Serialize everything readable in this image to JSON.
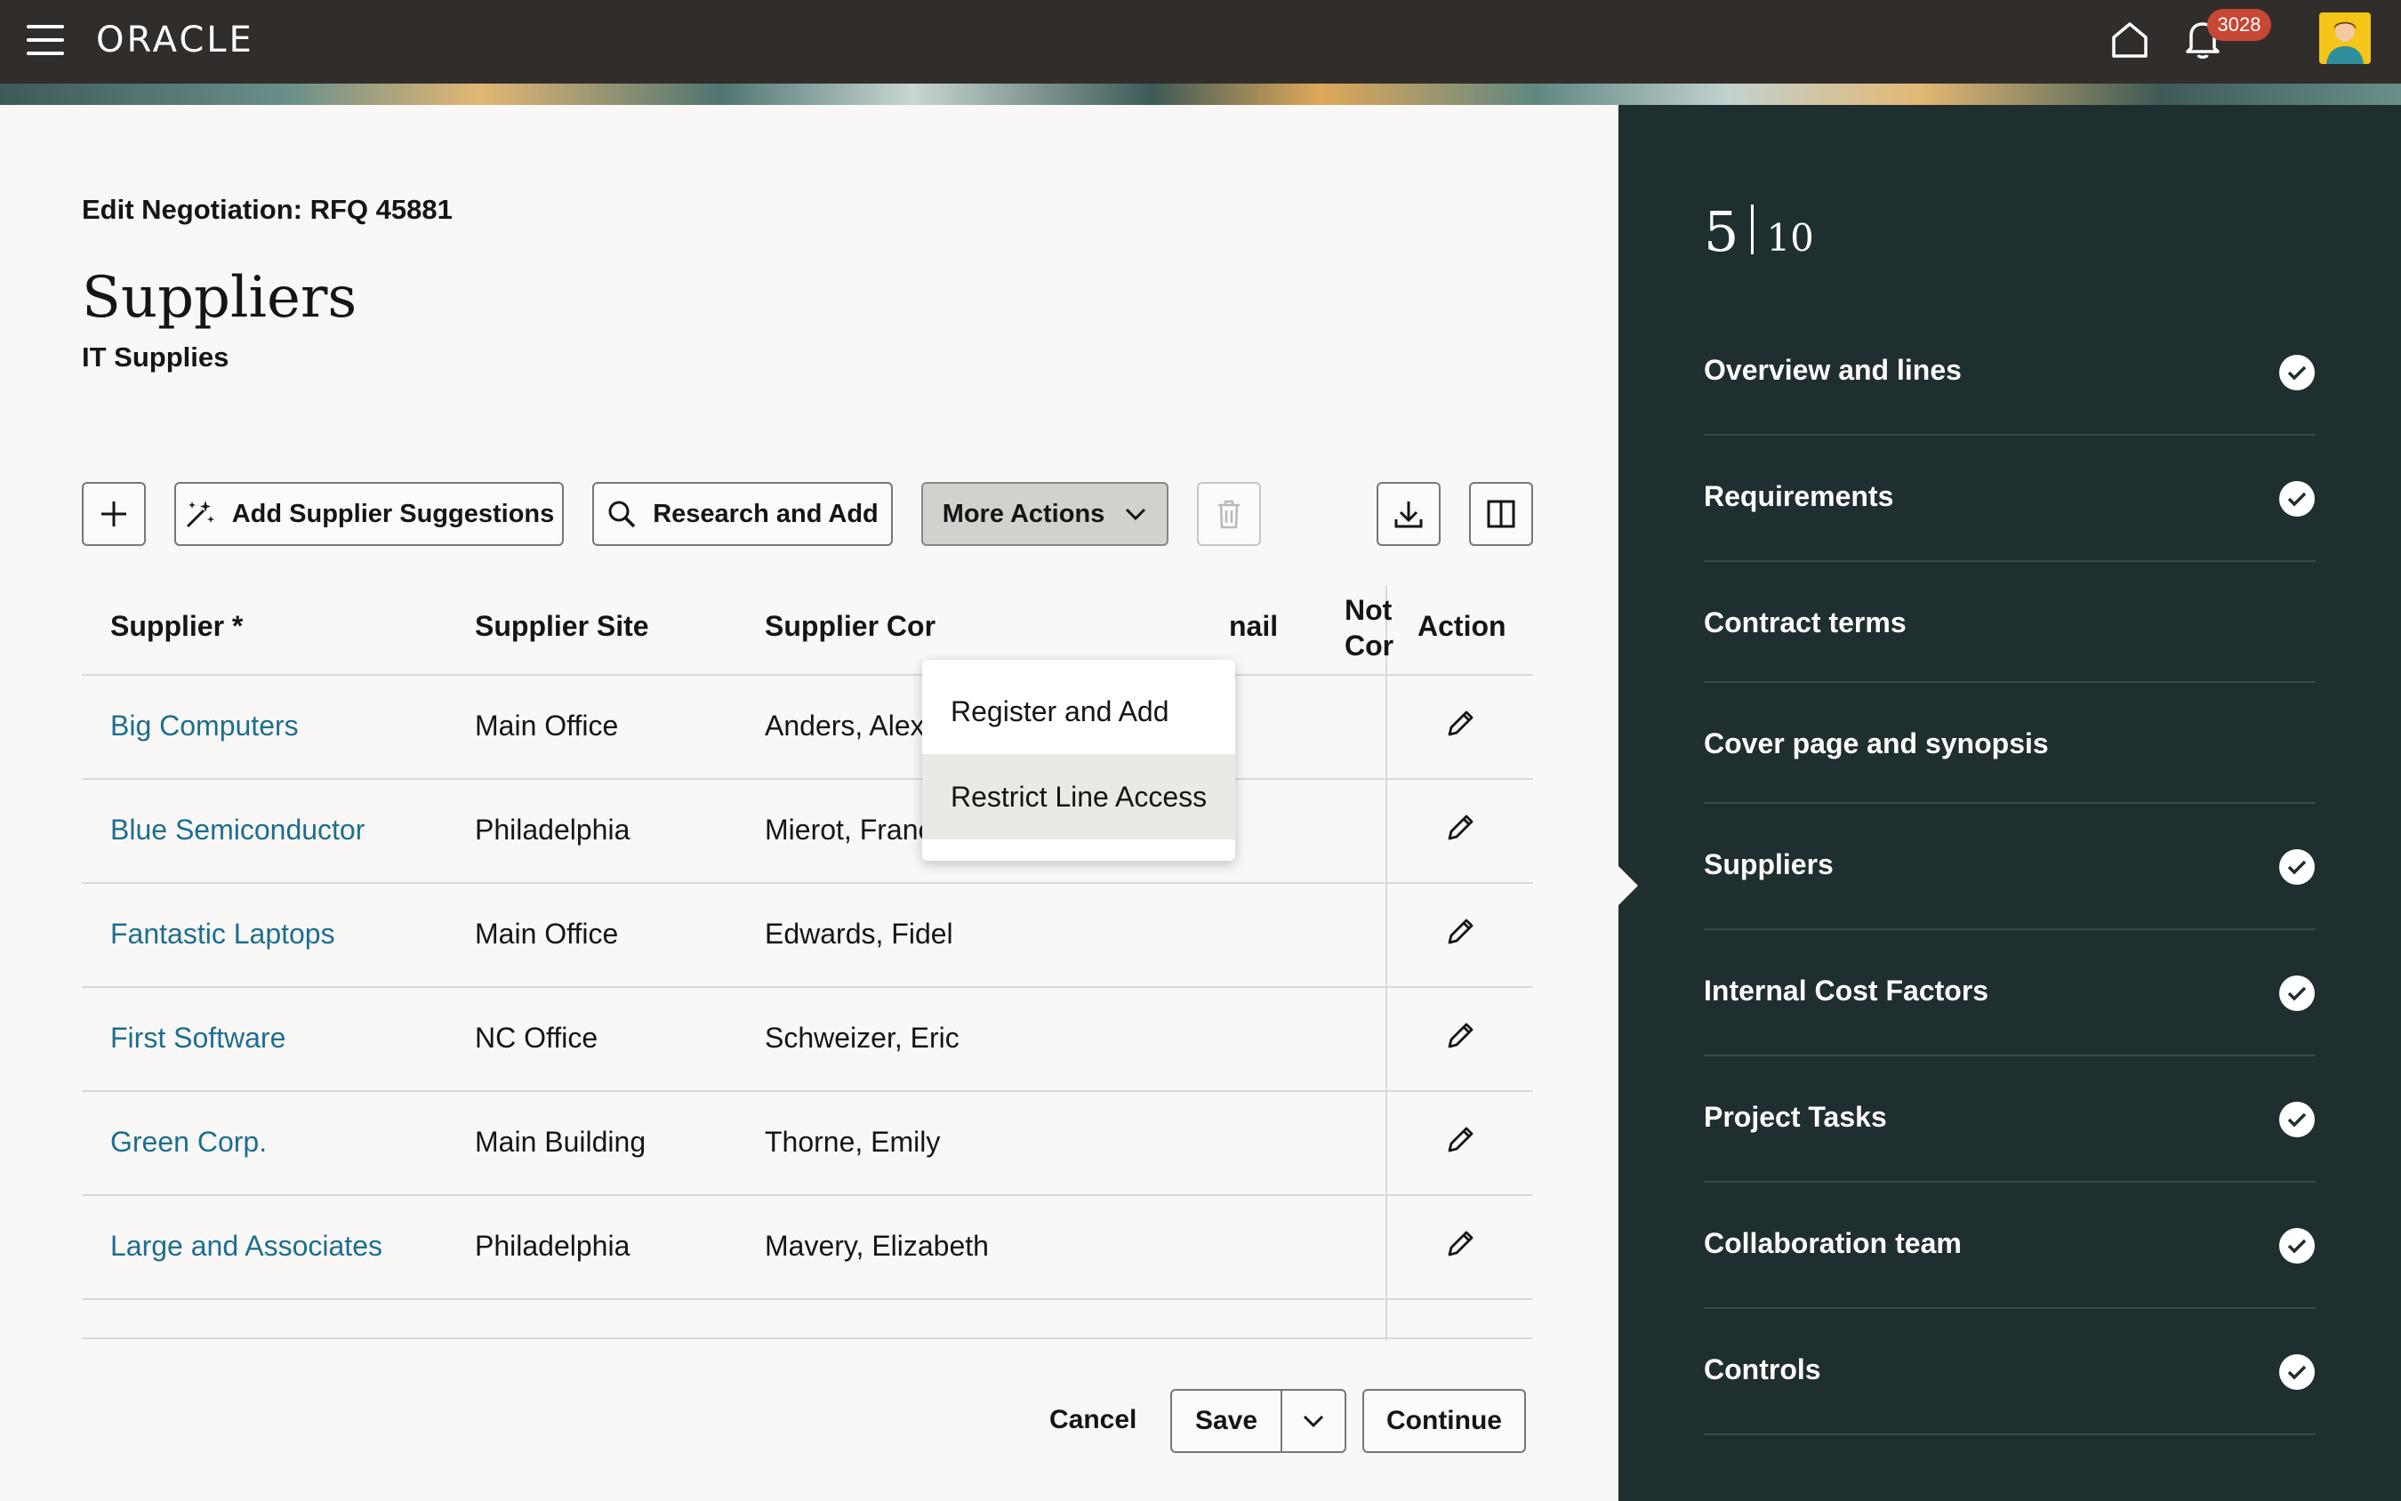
{
  "header": {
    "logo": "ORACLE",
    "notifications_count": "3028"
  },
  "page": {
    "breadcrumb": "Edit Negotiation: RFQ 45881",
    "title": "Suppliers",
    "subtitle": "IT Supplies"
  },
  "toolbar": {
    "add_supplier_suggestions": "Add Supplier Suggestions",
    "research_and_add": "Research and Add",
    "more_actions": "More Actions"
  },
  "more_actions_menu": {
    "items": [
      "Register and Add",
      "Restrict Line Access"
    ],
    "highlighted": "Restrict Line Access"
  },
  "table": {
    "columns": [
      "Supplier *",
      "Supplier Site",
      "Supplier Cor",
      "nail",
      "Not Cor",
      "Action"
    ],
    "rows": [
      {
        "supplier": "Big Computers",
        "site": "Main Office",
        "contact": "Anders, Alex"
      },
      {
        "supplier": "Blue Semiconductor",
        "site": "Philadelphia",
        "contact": "Mierot, Francois"
      },
      {
        "supplier": "Fantastic Laptops",
        "site": "Main Office",
        "contact": "Edwards, Fidel"
      },
      {
        "supplier": "First Software",
        "site": "NC Office",
        "contact": "Schweizer, Eric"
      },
      {
        "supplier": "Green Corp.",
        "site": "Main Building",
        "contact": "Thorne, Emily"
      },
      {
        "supplier": "Large and Associates",
        "site": "Philadelphia",
        "contact": "Mavery, Elizabeth"
      }
    ]
  },
  "footer": {
    "cancel": "Cancel",
    "save": "Save",
    "continue": "Continue"
  },
  "steps": {
    "current": "5",
    "total": "10",
    "items": [
      {
        "label": "Overview and lines",
        "complete": true
      },
      {
        "label": "Requirements",
        "complete": true
      },
      {
        "label": "Contract terms",
        "complete": false
      },
      {
        "label": "Cover page and synopsis",
        "complete": false
      },
      {
        "label": "Suppliers",
        "complete": true
      },
      {
        "label": "Internal Cost Factors",
        "complete": true
      },
      {
        "label": "Project Tasks",
        "complete": true
      },
      {
        "label": "Collaboration team",
        "complete": true
      },
      {
        "label": "Controls",
        "complete": true
      }
    ]
  },
  "colors": {
    "header_bg": "#312d2a",
    "side_panel_bg": "#1f2e2e",
    "link": "#1e6e8f",
    "badge": "#c74634"
  }
}
